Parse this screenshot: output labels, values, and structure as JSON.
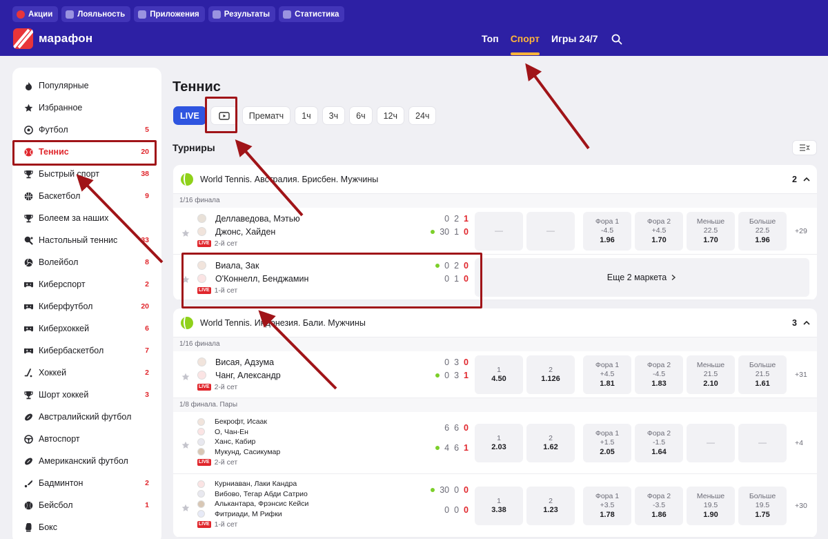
{
  "header": {
    "promo_tabs": [
      "Акции",
      "Лояльность",
      "Приложения",
      "Результаты",
      "Статистика"
    ],
    "logo_text": "марафон",
    "nav": [
      {
        "label": "Топ",
        "active": false
      },
      {
        "label": "Спорт",
        "active": true
      },
      {
        "label": "Игры 24/7",
        "active": false
      }
    ],
    "search_icon": "search-icon"
  },
  "sidebar": {
    "items": [
      {
        "label": "Популярные",
        "count": "",
        "icon": "fire-icon"
      },
      {
        "label": "Избранное",
        "count": "",
        "icon": "star-icon"
      },
      {
        "label": "Футбол",
        "count": "5",
        "icon": "soccer-ball-icon"
      },
      {
        "label": "Теннис",
        "count": "20",
        "icon": "tennis-ball-icon",
        "active": true
      },
      {
        "label": "Быстрый спорт",
        "count": "38",
        "icon": "trophy-icon"
      },
      {
        "label": "Баскетбол",
        "count": "9",
        "icon": "basketball-icon"
      },
      {
        "label": "Болеем за наших",
        "count": "",
        "icon": "trophy-icon"
      },
      {
        "label": "Настольный теннис",
        "count": "33",
        "icon": "table-tennis-icon"
      },
      {
        "label": "Волейбол",
        "count": "8",
        "icon": "volleyball-icon"
      },
      {
        "label": "Киберспорт",
        "count": "2",
        "icon": "gamepad-icon"
      },
      {
        "label": "Киберфутбол",
        "count": "20",
        "icon": "gamepad-icon"
      },
      {
        "label": "Киберхоккей",
        "count": "6",
        "icon": "gamepad-icon"
      },
      {
        "label": "Кибербаскетбол",
        "count": "7",
        "icon": "gamepad-icon"
      },
      {
        "label": "Хоккей",
        "count": "2",
        "icon": "hockey-stick-icon"
      },
      {
        "label": "Шорт хоккей",
        "count": "3",
        "icon": "trophy-icon"
      },
      {
        "label": "Австралийский футбол",
        "count": "",
        "icon": "rugby-ball-icon"
      },
      {
        "label": "Автоспорт",
        "count": "",
        "icon": "steering-wheel-icon"
      },
      {
        "label": "Американский футбол",
        "count": "",
        "icon": "rugby-ball-icon"
      },
      {
        "label": "Бадминтон",
        "count": "2",
        "icon": "shuttlecock-icon"
      },
      {
        "label": "Бейсбол",
        "count": "1",
        "icon": "baseball-icon"
      },
      {
        "label": "Бокс",
        "count": "",
        "icon": "boxing-glove-icon"
      }
    ]
  },
  "main": {
    "title": "Теннис",
    "filters": [
      "LIVE",
      "",
      "Прематч",
      "1ч",
      "3ч",
      "6ч",
      "12ч",
      "24ч"
    ],
    "section_title": "Турниры",
    "tournaments": [
      {
        "name": "World Tennis. Австралия. Брисбен. Мужчины",
        "count": "2",
        "rounds": [
          {
            "label": "1/16 финала",
            "matches": [
              {
                "players": [
                  "Деллаведова, Мэтью",
                  "Джонс, Хайден"
                ],
                "scores": [
                  [
                    "0",
                    "2",
                    "1"
                  ],
                  [
                    "30",
                    "1",
                    "0"
                  ]
                ],
                "serve": 1,
                "status": "2-й сет",
                "odds": [
                  {
                    "label": "",
                    "value": "—"
                  },
                  {
                    "label": "",
                    "value": "—"
                  },
                  {
                    "label": "Фора 1",
                    "sub": "-4.5",
                    "value": "1.96"
                  },
                  {
                    "label": "Фора 2",
                    "sub": "+4.5",
                    "value": "1.70"
                  },
                  {
                    "label": "Меньше",
                    "sub": "22.5",
                    "value": "1.70"
                  },
                  {
                    "label": "Больше",
                    "sub": "22.5",
                    "value": "1.96"
                  }
                ],
                "more": "+29"
              },
              {
                "players": [
                  "Виала, Зак",
                  "О'Коннелл, Бенджамин"
                ],
                "scores": [
                  [
                    "0",
                    "2",
                    "0"
                  ],
                  [
                    "0",
                    "1",
                    "0"
                  ]
                ],
                "serve": 0,
                "status": "1-й сет",
                "more_markets": "Еще 2 маркета"
              }
            ]
          }
        ]
      },
      {
        "name": "World Tennis. Индонезия. Бали. Мужчины",
        "count": "3",
        "rounds": [
          {
            "label": "1/16 финала",
            "matches": [
              {
                "players": [
                  "Висая, Адзума",
                  "Чанг, Александр"
                ],
                "scores": [
                  [
                    "0",
                    "3",
                    "0"
                  ],
                  [
                    "0",
                    "3",
                    "1"
                  ]
                ],
                "serve": 1,
                "status": "2-й сет",
                "odds": [
                  {
                    "label": "1",
                    "sub": "",
                    "value": "4.50"
                  },
                  {
                    "label": "2",
                    "sub": "",
                    "value": "1.126"
                  },
                  {
                    "label": "Фора 1",
                    "sub": "+4.5",
                    "value": "1.81"
                  },
                  {
                    "label": "Фора 2",
                    "sub": "-4.5",
                    "value": "1.83"
                  },
                  {
                    "label": "Меньше",
                    "sub": "21.5",
                    "value": "2.10"
                  },
                  {
                    "label": "Больше",
                    "sub": "21.5",
                    "value": "1.61"
                  }
                ],
                "more": "+31"
              }
            ]
          },
          {
            "label": "1/8 финала. Пары",
            "matches": [
              {
                "players": [
                  "Бекрофт, Исаак",
                  "О, Чан-Ен",
                  "Ханс, Кабир",
                  "Мукунд, Сасикумар"
                ],
                "scores": [
                  [
                    "6",
                    "6",
                    "0"
                  ],
                  [
                    "4",
                    "6",
                    "1"
                  ]
                ],
                "serve": 1,
                "status": "2-й сет",
                "odds": [
                  {
                    "label": "1",
                    "sub": "",
                    "value": "2.03"
                  },
                  {
                    "label": "2",
                    "sub": "",
                    "value": "1.62"
                  },
                  {
                    "label": "Фора 1",
                    "sub": "+1.5",
                    "value": "2.05"
                  },
                  {
                    "label": "Фора 2",
                    "sub": "-1.5",
                    "value": "1.64"
                  },
                  {
                    "label": "",
                    "value": "—"
                  },
                  {
                    "label": "",
                    "value": "—"
                  }
                ],
                "more": "+4"
              },
              {
                "players": [
                  "Курниаван, Лаки Кандра",
                  "Вибово, Тегар Абди Сатрио",
                  "Алькантара, Фрэнсис Кейси",
                  "Фитриади, М Рифки"
                ],
                "scores": [
                  [
                    "30",
                    "0",
                    "0"
                  ],
                  [
                    "0",
                    "0",
                    "0"
                  ]
                ],
                "serve": 0,
                "status": "1-й сет",
                "odds": [
                  {
                    "label": "1",
                    "sub": "",
                    "value": "3.38"
                  },
                  {
                    "label": "2",
                    "sub": "",
                    "value": "1.23"
                  },
                  {
                    "label": "Фора 1",
                    "sub": "+3.5",
                    "value": "1.78"
                  },
                  {
                    "label": "Фора 2",
                    "sub": "-3.5",
                    "value": "1.86"
                  },
                  {
                    "label": "Меньше",
                    "sub": "19.5",
                    "value": "1.90"
                  },
                  {
                    "label": "Больше",
                    "sub": "19.5",
                    "value": "1.75"
                  }
                ],
                "more": "+30"
              }
            ]
          }
        ]
      }
    ],
    "live_badge": "LIVE"
  },
  "colors": {
    "header_bg": "#2d20a4",
    "accent_orange": "#ffb43a",
    "accent_red": "#e0262c",
    "live_blue": "#2f55e0",
    "annotation_red": "#a01418"
  }
}
